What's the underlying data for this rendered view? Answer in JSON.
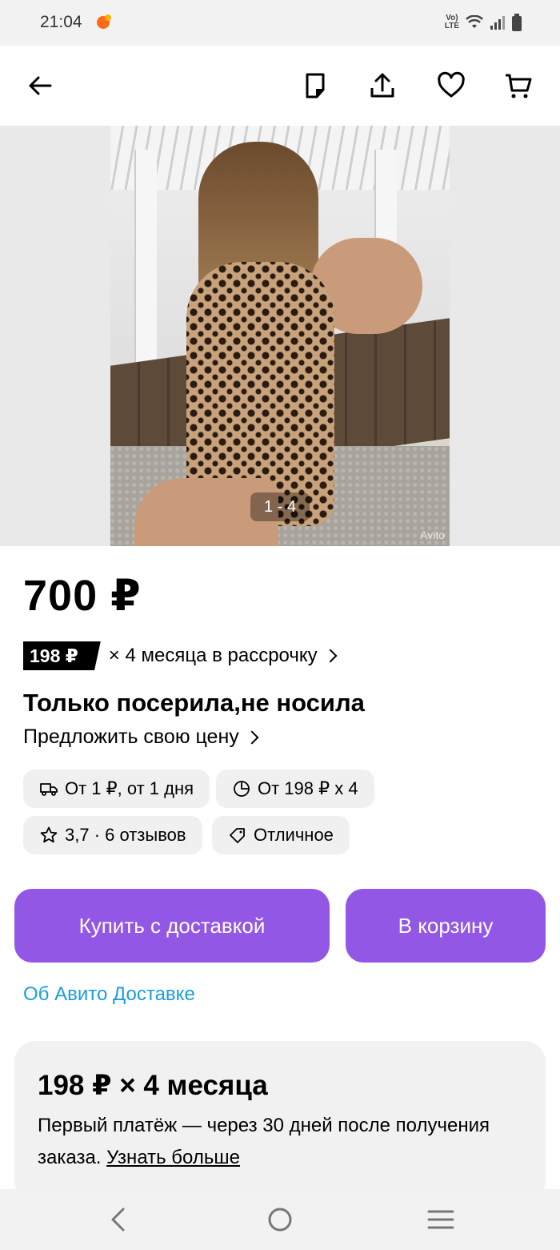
{
  "status_bar": {
    "time": "21:04",
    "network": "LTE"
  },
  "gallery": {
    "counter": "1 - 4",
    "watermark": "Avito"
  },
  "listing": {
    "price": "700 ₽",
    "installment_badge": "198 ₽",
    "installment_text": "× 4 месяца в рассрочку",
    "title": "Только посерила,не носила",
    "offer_price": "Предложить свою цену"
  },
  "chips": {
    "delivery": "От 1 ₽, от 1 дня",
    "installment": "От 198 ₽ x 4",
    "rating": "3,7 · 6 отзывов",
    "condition": "Отличное"
  },
  "actions": {
    "buy_with_delivery": "Купить с доставкой",
    "add_to_cart": "В корзину",
    "about_delivery": "Об Авито Доставке"
  },
  "installment_card": {
    "title": "198 ₽ × 4 месяца",
    "text": "Первый платёж — через 30 дней после получения заказа.",
    "link": "Узнать больше"
  },
  "colors": {
    "accent": "#9357e6",
    "link": "#1a9dd9"
  }
}
